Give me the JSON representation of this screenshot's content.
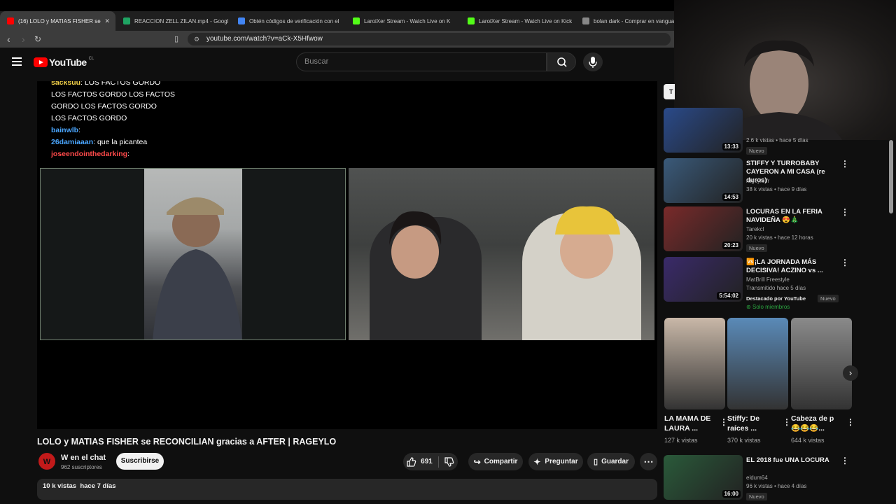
{
  "browser": {
    "tabs": [
      {
        "title": "(16) LOLO y MATIAS FISHER se",
        "active": true,
        "favicon_color": "#ff0000"
      },
      {
        "title": "REACCION ZELL ZILAN.mp4 - Google",
        "active": false,
        "favicon_color": "#1fa463"
      },
      {
        "title": "Obtén códigos de verificación con el",
        "active": false,
        "favicon_color": "#4285f4"
      },
      {
        "title": "LaroiXer Stream - Watch Live on K",
        "active": false,
        "favicon_color": "#53fc18"
      },
      {
        "title": "LaroiXer Stream - Watch Live on Kick",
        "active": false,
        "favicon_color": "#53fc18"
      },
      {
        "title": "bolan dark - Comprar en vanguar",
        "active": false,
        "favicon_color": "#888888"
      }
    ],
    "url": "youtube.com/watch?v=aCk-X5Hfwow"
  },
  "youtube": {
    "logo_text": "YouTube",
    "country": "CL",
    "search_placeholder": "Buscar"
  },
  "chat": [
    {
      "user": "sacksuu",
      "text": ": LOS FACTOS GORDO"
    },
    {
      "user": "",
      "text": "LOS FACTOS GORDO LOS FACTOS"
    },
    {
      "user": "",
      "text": "GORDO LOS FACTOS GORDO"
    },
    {
      "user": "",
      "text": "LOS FACTOS GORDO"
    },
    {
      "user": "bainwlb",
      "text": ":"
    },
    {
      "user": "26damiaaan",
      "text": ": que la picantea"
    },
    {
      "user": "joseendointhedarking",
      "text": ":"
    }
  ],
  "video": {
    "title": "LOLO y MATIAS FISHER se RECONCILIAN gracias a AFTER | RAGEYLO",
    "channel": "W en el chat",
    "subscribers": "962 suscriptores",
    "subscribe": "Suscribirse",
    "likes": "691",
    "share": "Compartir",
    "ask": "Preguntar",
    "save": "Guardar",
    "views_date": "10 k vistas  hace 7 días"
  },
  "recommendations": [
    {
      "title": "",
      "channel": "",
      "meta": "2.6 k vistas • hace 5 días",
      "duration": "13:33",
      "badge": "Nuevo",
      "thumb_color": "#2a4a8a"
    },
    {
      "title": "STIFFY Y TURROBABY CAYERON A MI CASA (re duros)",
      "channel": "rageylo fr",
      "meta": "38 k vistas • hace 9 días",
      "duration": "14:53",
      "badge": "",
      "thumb_color": "#3a5a7a"
    },
    {
      "title": "LOCURAS EN LA FERIA NAVIDEÑA 😍🎄",
      "channel": "Tarekcl",
      "meta": "20 k vistas • hace 12 horas",
      "duration": "20:23",
      "badge": "Nuevo",
      "thumb_color": "#7a2a2a"
    },
    {
      "title": "🆚¡LA JORNADA MÁS DECISIVA! ACZINO vs ...",
      "channel": "MatBrill Freestyle",
      "meta": "Transmitido hace 5 días",
      "duration": "5:54:02",
      "badge": "Destacado por YouTube",
      "badge2": "Nuevo",
      "members": "Solo miembros",
      "thumb_color": "#3a2a6a"
    },
    {
      "title": "EL 2018 fue UNA LOCURA",
      "channel": "eldum64",
      "meta": "96 k vistas • hace 4 días",
      "duration": "16:00",
      "badge": "Nuevo",
      "thumb_color": "#2a5a3a"
    }
  ],
  "shorts": [
    {
      "title": "LA MAMA DE LAURA ...",
      "views": "127 k vistas",
      "color": "#c9b8a8"
    },
    {
      "title": "Stiffy: De raíces ...",
      "views": "370 k vistas",
      "color": "#5a8ab8"
    },
    {
      "title": "Cabeza de p 😂😂😂...",
      "views": "644 k vistas",
      "color": "#8a8a8a"
    }
  ]
}
